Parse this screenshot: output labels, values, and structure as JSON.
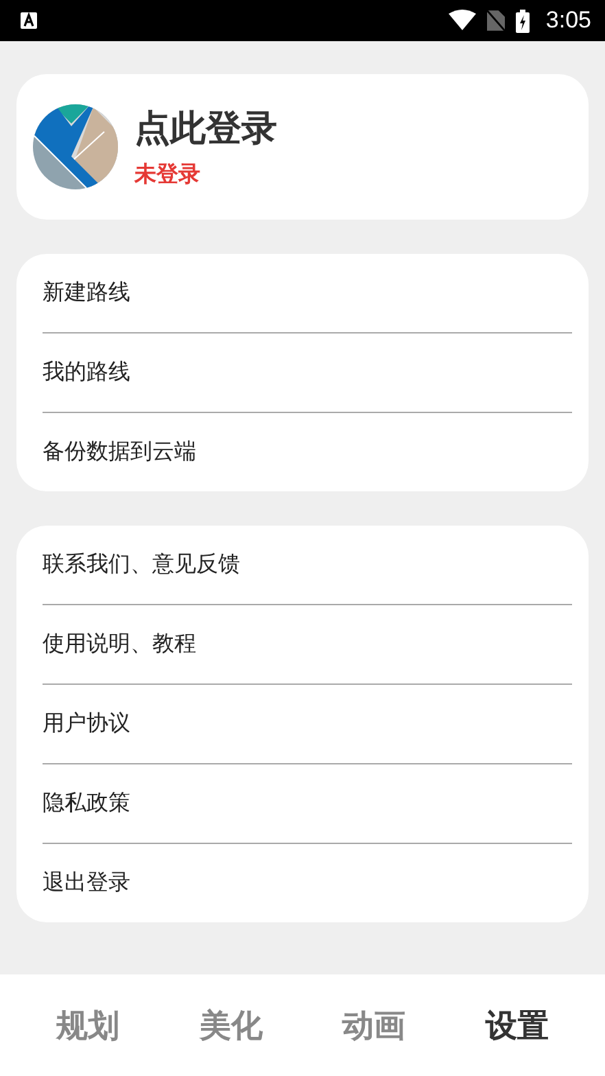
{
  "status_bar": {
    "time": "3:05"
  },
  "profile": {
    "title": "点此登录",
    "status": "未登录"
  },
  "menu_groups": [
    {
      "items": [
        {
          "label": "新建路线"
        },
        {
          "label": "我的路线"
        },
        {
          "label": "备份数据到云端"
        }
      ]
    },
    {
      "items": [
        {
          "label": "联系我们、意见反馈"
        },
        {
          "label": "使用说明、教程"
        },
        {
          "label": "用户协议"
        },
        {
          "label": "隐私政策"
        },
        {
          "label": "退出登录"
        }
      ]
    }
  ],
  "tabs": [
    {
      "label": "规划",
      "selected": false
    },
    {
      "label": "美化",
      "selected": false
    },
    {
      "label": "动画",
      "selected": false
    },
    {
      "label": "设置",
      "selected": true
    }
  ]
}
